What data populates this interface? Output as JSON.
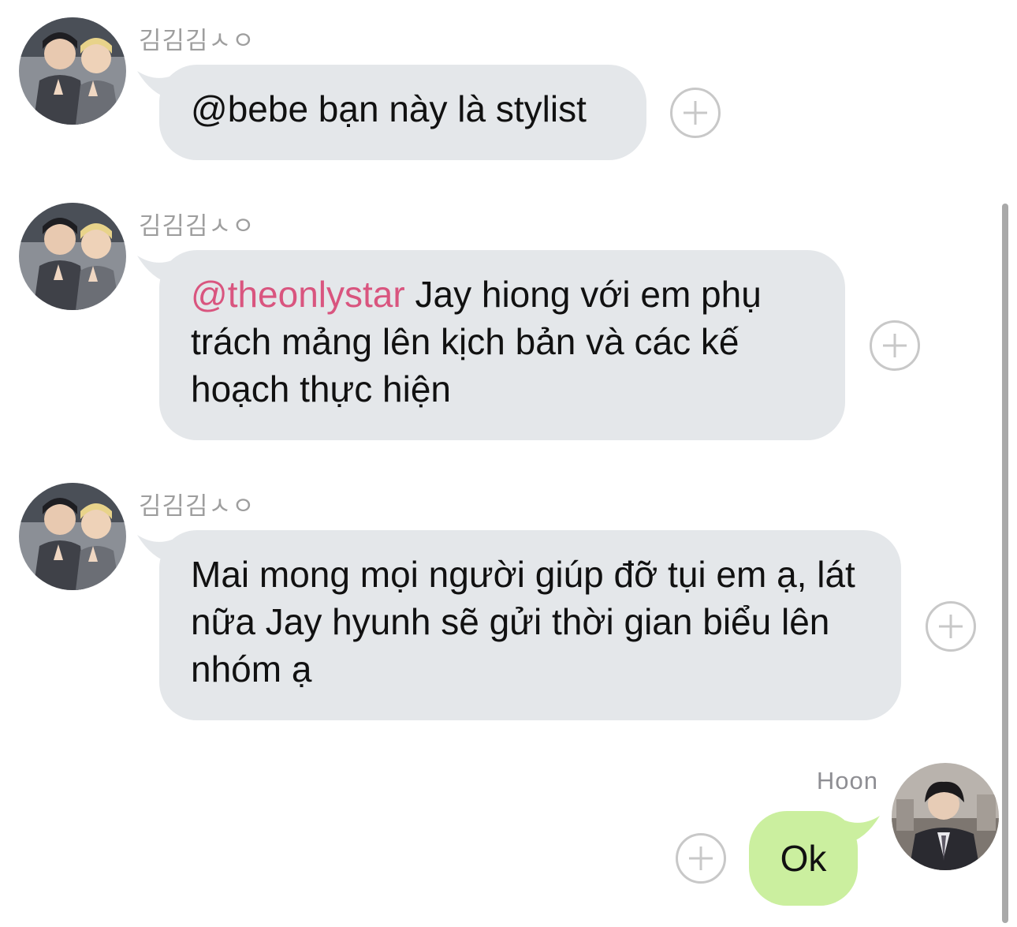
{
  "messages": [
    {
      "sender": "김김김ㅅㅇ",
      "avatar_icon": "group-photo-avatar",
      "text": "@bebe bạn này là stylist",
      "mention": "",
      "direction": "incoming"
    },
    {
      "sender": "김김김ㅅㅇ",
      "avatar_icon": "group-photo-avatar",
      "mention": "@theonlystar",
      "text": " Jay hiong với em phụ trách mảng lên kịch bản và các kế hoạch thực hiện",
      "direction": "incoming"
    },
    {
      "sender": "김김김ㅅㅇ",
      "avatar_icon": "group-photo-avatar",
      "text": "Mai mong mọi người giúp đỡ tụi em ạ, lát nữa Jay hyunh sẽ gửi thời gian biểu lên nhóm ạ",
      "mention": "",
      "direction": "incoming"
    },
    {
      "sender": "Hoon",
      "avatar_icon": "profile-photo-avatar",
      "text": "Ok",
      "mention": "",
      "direction": "outgoing"
    }
  ],
  "colors": {
    "incoming_bubble": "#e4e7ea",
    "outgoing_bubble": "#cbef9f",
    "mention": "#d9557f",
    "sender_name": "#9e9e9e"
  },
  "icons": {
    "add_reaction": "plus-circle-icon"
  }
}
